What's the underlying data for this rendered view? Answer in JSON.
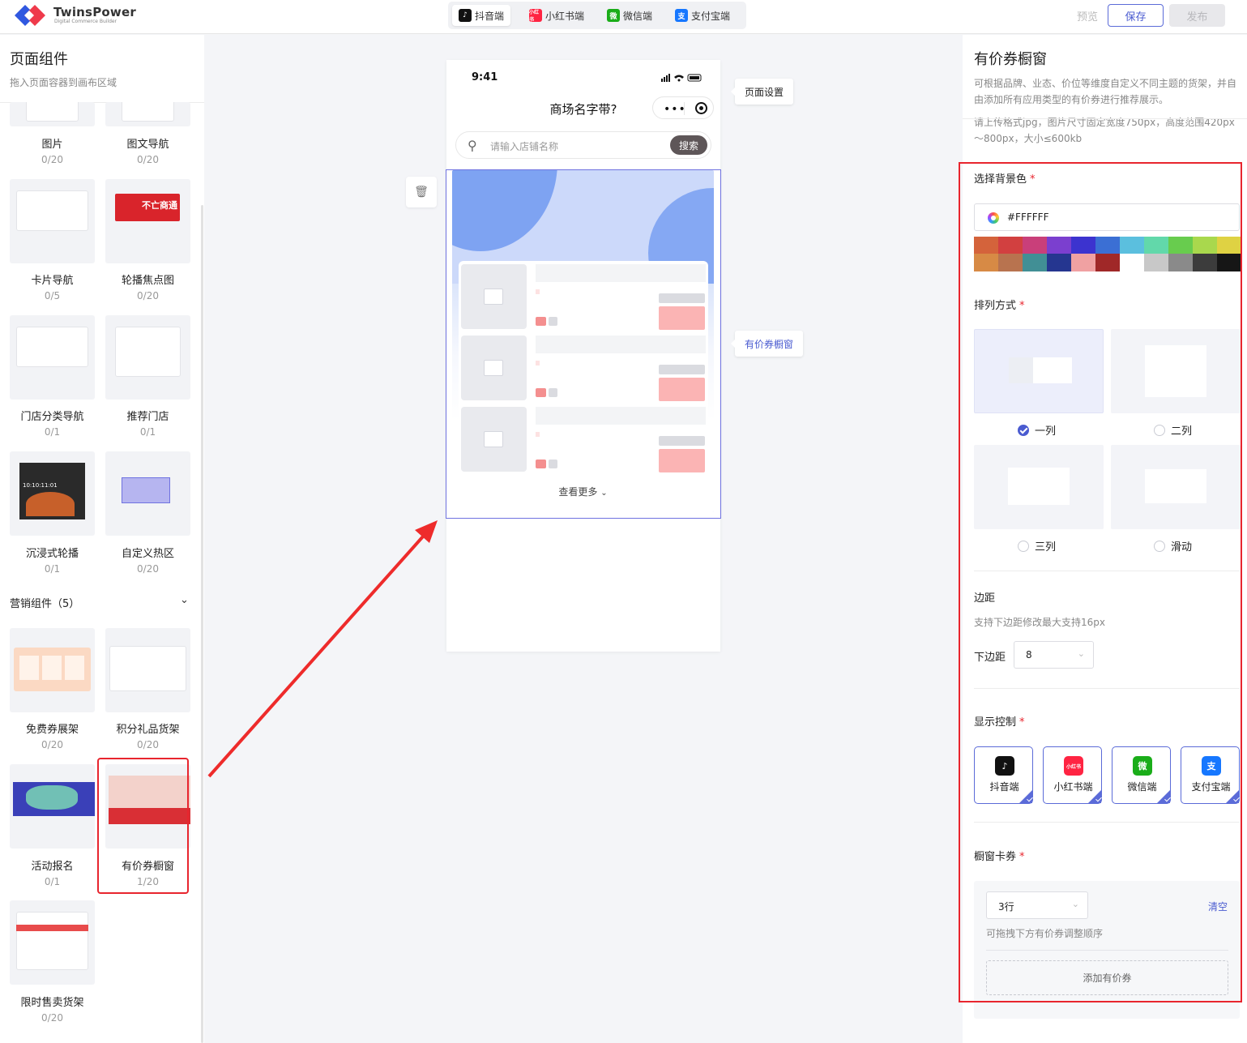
{
  "app": {
    "name": "TwinsPower",
    "tagline": "Digital Commerce Builder"
  },
  "platform_tabs": [
    {
      "label": "抖音端",
      "active": true,
      "color": "#111111"
    },
    {
      "label": "小红书端",
      "active": false,
      "color": "#ff2442"
    },
    {
      "label": "微信端",
      "active": false,
      "color": "#1aad19"
    },
    {
      "label": "支付宝端",
      "active": false,
      "color": "#1677ff"
    }
  ],
  "top_actions": {
    "preview": "预览",
    "save": "保存",
    "publish": "发布"
  },
  "left_panel": {
    "title": "页面组件",
    "subtitle": "拖入页面容器到画布区域",
    "components": [
      {
        "name": "图片",
        "count": "0/20"
      },
      {
        "name": "图文导航",
        "count": "0/20"
      },
      {
        "name": "卡片导航",
        "count": "0/5"
      },
      {
        "name": "轮播焦点图",
        "count": "0/20"
      },
      {
        "name": "门店分类导航",
        "count": "0/1"
      },
      {
        "name": "推荐门店",
        "count": "0/1"
      },
      {
        "name": "沉浸式轮播",
        "count": "0/1"
      },
      {
        "name": "自定义热区",
        "count": "0/20"
      }
    ],
    "marketing_section": "营销组件（5）",
    "marketing": [
      {
        "name": "免费券展架",
        "count": "0/20"
      },
      {
        "name": "积分礼品货架",
        "count": "0/20"
      },
      {
        "name": "活动报名",
        "count": "0/1"
      },
      {
        "name": "有价券橱窗",
        "count": "1/20"
      },
      {
        "name": "限时售卖货架",
        "count": "0/20"
      }
    ],
    "thumb_texts": {
      "banner": "不亡商通",
      "countdown": "10:10:11:01"
    }
  },
  "canvas": {
    "time": "9:41",
    "mall_title": "商场名字带?",
    "search_placeholder": "请输入店铺名称",
    "search_button": "搜索",
    "see_more": "查看更多",
    "tip_page_settings": "页面设置",
    "tip_component": "有价券橱窗"
  },
  "right_panel": {
    "title": "有价券橱窗",
    "description": "可根据品牌、业态、价位等维度自定义不同主题的货架，并自由添加所有应用类型的有价券进行推荐展示。",
    "upload_hint": "请上传格式jpg，图片尺寸固定宽度750px，高度范围420px～800px，大小≤600kb",
    "bg_color_label": "选择背景色",
    "bg_color_value": "#FFFFFF",
    "swatches": [
      "#d4633b",
      "#d24040",
      "#c93f7a",
      "#7b3fcf",
      "#3c33cf",
      "#3b6fd4",
      "#5bbfde",
      "#62d8aa",
      "#68cc4e",
      "#a9d84d",
      "#dfd243",
      "#d78a45",
      "#b8734f",
      "#418f95",
      "#253690",
      "#f0a1a2",
      "#a02828",
      "#ffffff",
      "#c8c8c8",
      "#8a8a8a",
      "#3c3c3c",
      "#161616"
    ],
    "layout_label": "排列方式",
    "layouts": [
      {
        "label": "一列",
        "selected": true
      },
      {
        "label": "二列",
        "selected": false
      },
      {
        "label": "三列",
        "selected": false
      },
      {
        "label": "滑动",
        "selected": false
      }
    ],
    "margin_label": "边距",
    "margin_hint": "支持下边距修改最大支持16px",
    "bottom_margin_label": "下边距",
    "bottom_margin_value": "8",
    "display_label": "显示控制",
    "display_platforms": [
      {
        "label": "抖音端",
        "color": "#111111",
        "glyph": "♪"
      },
      {
        "label": "小红书端",
        "color": "#ff2442",
        "glyph": "小红书"
      },
      {
        "label": "微信端",
        "color": "#1aad19",
        "glyph": "微"
      },
      {
        "label": "支付宝端",
        "color": "#1677ff",
        "glyph": "支"
      }
    ],
    "coupon_label": "橱窗卡券",
    "rows_value": "3行",
    "clear": "清空",
    "drag_hint": "可拖拽下方有价券调整顺序",
    "add_coupon": "添加有价券"
  },
  "accent": "#4a5bd0",
  "highlight": "#e8252e"
}
